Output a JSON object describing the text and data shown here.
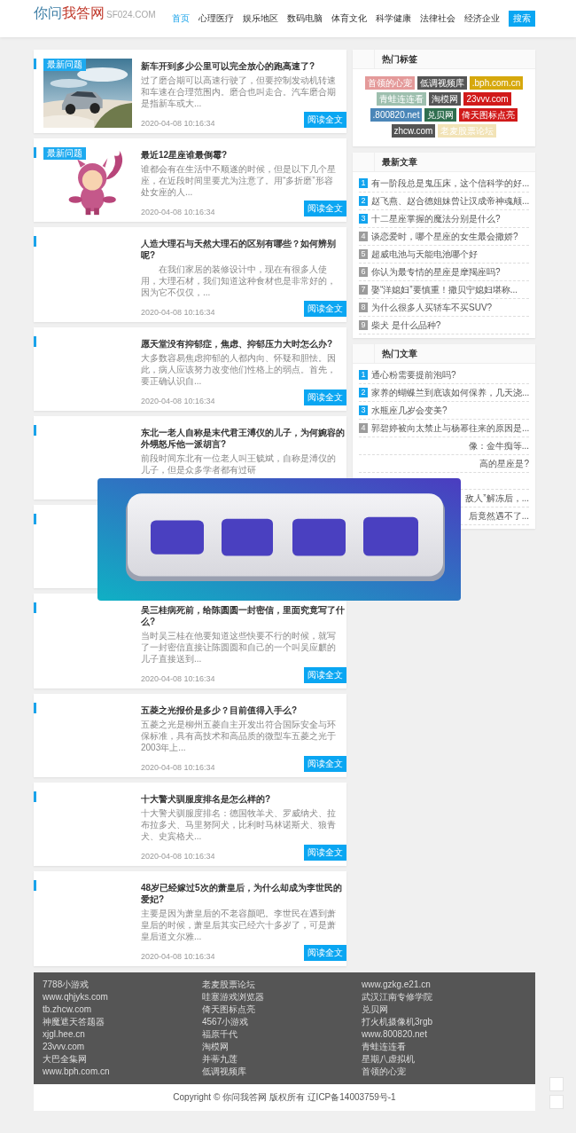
{
  "header": {
    "logo": {
      "parts": [
        "你问",
        "我答网"
      ],
      "domain": "SF024.COM"
    },
    "nav": [
      {
        "label": "首页",
        "selected": true
      },
      {
        "label": "心理医疗",
        "selected": false
      },
      {
        "label": "娱乐地区",
        "selected": false
      },
      {
        "label": "数码电脑",
        "selected": false
      },
      {
        "label": "体育文化",
        "selected": false
      },
      {
        "label": "科学健康",
        "selected": false
      },
      {
        "label": "法律社会",
        "selected": false
      },
      {
        "label": "经济企业",
        "selected": false
      }
    ],
    "search_button": "搜索"
  },
  "articles": [
    {
      "kind": "picture",
      "badge": "最新问题",
      "title": "新车开到多少公里可以完全放心的跑高速了?",
      "summary": "过了磨合期可以高速行驶了，但要控制发动机转速和车速在合理范围内。磨合也叫走合。汽车磨合期是指新车或大...",
      "date": "2020-04-08 10:16:34",
      "button": "阅读全文"
    },
    {
      "kind": "picture",
      "badge": "最新问题",
      "title": "最近12星座谁最倒霉?",
      "summary": "谁都会有在生活中不顺遂的时候，但是以下几个星座，在近段时间里要尤为注意了。用“多折磨”形容处女座的人...",
      "date": "2020-04-08 10:16:34",
      "button": "阅读全文"
    },
    {
      "kind": "text",
      "title": "人造大理石与天然大理石的区别有哪些？如何辨别呢?",
      "summary": "　　在我们家居的装修设计中，现在有很多人使用，大理石材，我们知道这种食材也是非常好的，因为它不仅仅，...",
      "date": "2020-04-08 10:16:34",
      "button": "阅读全文"
    },
    {
      "kind": "text",
      "title": "愿天堂没有抑郁症，焦虑、抑郁压力大时怎么办?",
      "summary": "大多数容易焦虑抑郁的人都内向、怀疑和胆怯。因此，病人应该努力改变他们性格上的弱点。首先，要正确认识自...",
      "date": "2020-04-08 10:16:34",
      "button": "阅读全文"
    },
    {
      "kind": "text",
      "title": "东北一老人自称是末代君王溥仪的儿子，为何婉容的外甥怒斥他一派胡言?",
      "summary": "前段时间东北有一位老人叫王毓斌，自称是溥仪的儿子，但是众多学者都有过研"
    },
    {
      "kind": "hidden"
    },
    {
      "kind": "text",
      "title": "吴三桂病死前，给陈圆圆一封密信，里面究竟写了什么?",
      "summary": "当时吴三桂在他要知道这些快要不行的时候，就写了一封密信直接让陈圆圆和自己的一个叫吴应麒的儿子直接送到...",
      "date": "2020-04-08 10:16:34",
      "button": "阅读全文"
    },
    {
      "kind": "text",
      "title": "五菱之光报价是多少？目前值得入手么?",
      "summary": "五菱之光是柳州五菱自主开发出符合国际安全与环保标准，具有高技术和高品质的微型车五菱之光于2003年上...",
      "date": "2020-04-08 10:16:34",
      "button": "阅读全文"
    },
    {
      "kind": "text",
      "title": "十大警犬驯服度排名是怎么样的?",
      "summary": "十大警犬驯服度排名：德国牧羊犬、罗威纳犬、拉布拉多犬、马里努阿犬，比利时马林诺斯犬、狼青犬、史宾格犬...",
      "date": "2020-04-08 10:16:34",
      "button": "阅读全文"
    },
    {
      "kind": "text",
      "title": "48岁已经嫁过5次的萧皇后，为什么却成为李世民的爱妃?",
      "summary": "主要是因为萧皇后的不老容颜吧。李世民在遇到萧皇后的时候，萧皇后其实已经六十多岁了，可是萧皇后道文尔雅...",
      "date": "2020-04-08 10:16:34",
      "button": "阅读全文"
    }
  ],
  "sidebar": {
    "tags": {
      "title": "热门标签",
      "items": [
        {
          "label": "首领的心宠",
          "color": "#e49a9a"
        },
        {
          "label": "低调视频库",
          "color": "#555555"
        },
        {
          "label": ".bph.com.cn",
          "color": "#d6a80c"
        },
        {
          "label": "青蛙连连看",
          "color": "#9dbfae"
        },
        {
          "label": "淘模网",
          "color": "#555555"
        },
        {
          "label": "23vvv.com",
          "color": "#d11a1a"
        },
        {
          "label": ".800820.net",
          "color": "#4a86b8"
        },
        {
          "label": "兑贝网",
          "color": "#2f6e4f"
        },
        {
          "label": "倚天图标点亮",
          "color": "#d11a1a"
        },
        {
          "label": "zhcw.com",
          "color": "#555555"
        },
        {
          "label": "老麦股票论坛",
          "color": "#f2e3b6"
        }
      ]
    },
    "latest": {
      "title": "最新文章",
      "items": [
        {
          "num": "1",
          "top": true,
          "text": "有一阶段总是鬼压床，这个信科学的好..."
        },
        {
          "num": "2",
          "top": true,
          "text": "赵飞燕、赵合德姐妹曾让汉成帝神魂颠..."
        },
        {
          "num": "3",
          "top": true,
          "text": "十二星座掌握的魔法分别是什么?"
        },
        {
          "num": "4",
          "top": false,
          "text": "谈恋爱时，哪个星座的女生最会撒娇?"
        },
        {
          "num": "5",
          "top": false,
          "text": "超威电池与天能电池哪个好"
        },
        {
          "num": "6",
          "top": false,
          "text": "你认为最专情的星座是摩羯座吗?"
        },
        {
          "num": "7",
          "top": false,
          "text": "娶“洋媳妇”要慎重！撒贝宁媳妇堪称..."
        },
        {
          "num": "8",
          "top": false,
          "text": "为什么很多人买轿车不买SUV?"
        },
        {
          "num": "9",
          "top": false,
          "text": "柴犬 是什么品种?"
        }
      ]
    },
    "hot": {
      "title": "热门文章",
      "items": [
        {
          "kind": "full",
          "num": "1",
          "top": true,
          "text": "通心粉需要提前泡吗?"
        },
        {
          "kind": "full",
          "num": "2",
          "top": true,
          "text": "家养的蝴蝶兰到底该如何保养，几天浇..."
        },
        {
          "kind": "full",
          "num": "3",
          "top": true,
          "text": "水瓶座几岁会变美?"
        },
        {
          "kind": "full",
          "num": "4",
          "top": false,
          "text": "郭碧婷被向太禁止与杨幂往来的原因是..."
        },
        {
          "kind": "partial",
          "text": "像：金牛痴等..."
        },
        {
          "kind": "partial",
          "text": "高的星座是?"
        },
        {
          "kind": "hidden"
        },
        {
          "kind": "partial",
          "text": "敌人”解冻后，..."
        },
        {
          "kind": "partial",
          "text": "后竟然遇不了..."
        }
      ]
    }
  },
  "footer": {
    "columns": [
      [
        "7788小游戏",
        "www.qhjyks.com",
        "tb.zhcw.com",
        "神魔遮天答题器",
        "xjgl.hee.cn",
        "23vvv.com",
        "大巴全集网",
        "www.bph.com.cn"
      ],
      [
        "老麦股票论坛",
        "哇塞游戏浏览器",
        "倚天图标点亮",
        "4567小游戏",
        "福原千代",
        "淘模网",
        "并蒂九莲",
        "低调视频库"
      ],
      [
        "www.gzkg.e21.cn",
        "武汉江南专修学院",
        "兑贝网",
        "打火机摄像机3rgb",
        "www.800820.net",
        "青蛙连连看",
        "星期八虚拟机",
        "首领的心宠"
      ]
    ],
    "copyright": "Copyright © 你问我答网 版权所有 辽ICP备14003759号-1"
  }
}
